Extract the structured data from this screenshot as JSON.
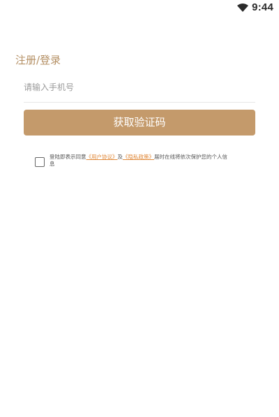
{
  "status_bar": {
    "time": "9:44",
    "wifi_icon": "wifi-icon"
  },
  "login": {
    "title": "注册/登录",
    "phone_placeholder": "请输入手机号",
    "button_label": "获取验证码"
  },
  "agreement": {
    "prefix": "登陆即表示同意",
    "user_agreement_link": "《用户协议》",
    "conjunction": "及",
    "privacy_policy_link": "《隐私政策》",
    "suffix": "届时在线将依次保护您的个人信息",
    "checked": false
  },
  "colors": {
    "accent": "#c49a6b",
    "title": "#b48f63",
    "link": "#e0893a"
  }
}
